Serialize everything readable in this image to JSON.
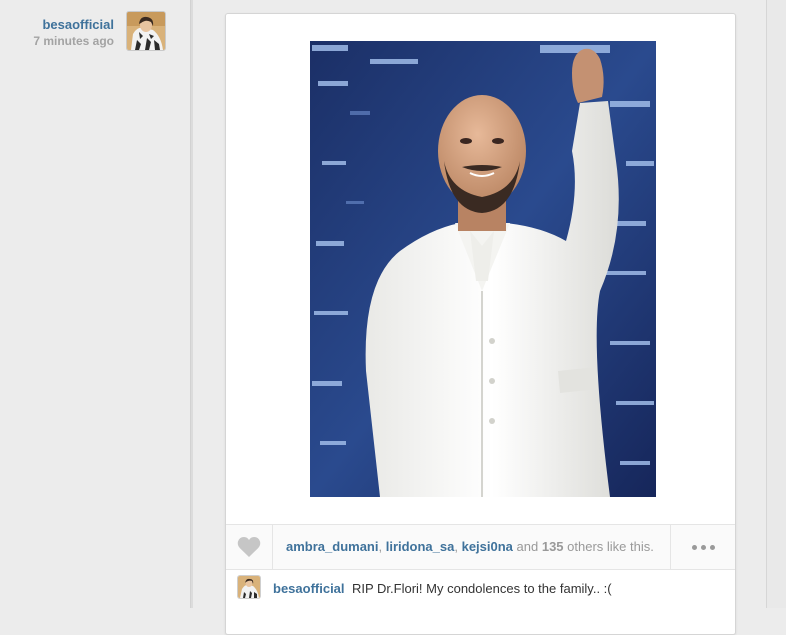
{
  "post": {
    "author": "besaofficial",
    "time_ago": "7 minutes ago"
  },
  "likes": {
    "users": [
      "ambra_dumani",
      "liridona_sa",
      "kejsi0na"
    ],
    "sep1": ", ",
    "sep2": ", ",
    "and_text": " and ",
    "count": "135",
    "suffix": " others like this."
  },
  "caption": {
    "user": "besaofficial",
    "text": "RIP Dr.Flori! My condolences to the family.. :("
  },
  "icons": {
    "like": "heart-icon",
    "more": "more-options-icon"
  },
  "colors": {
    "username": "#3f729b",
    "muted": "#999999",
    "background": "#ececec"
  }
}
